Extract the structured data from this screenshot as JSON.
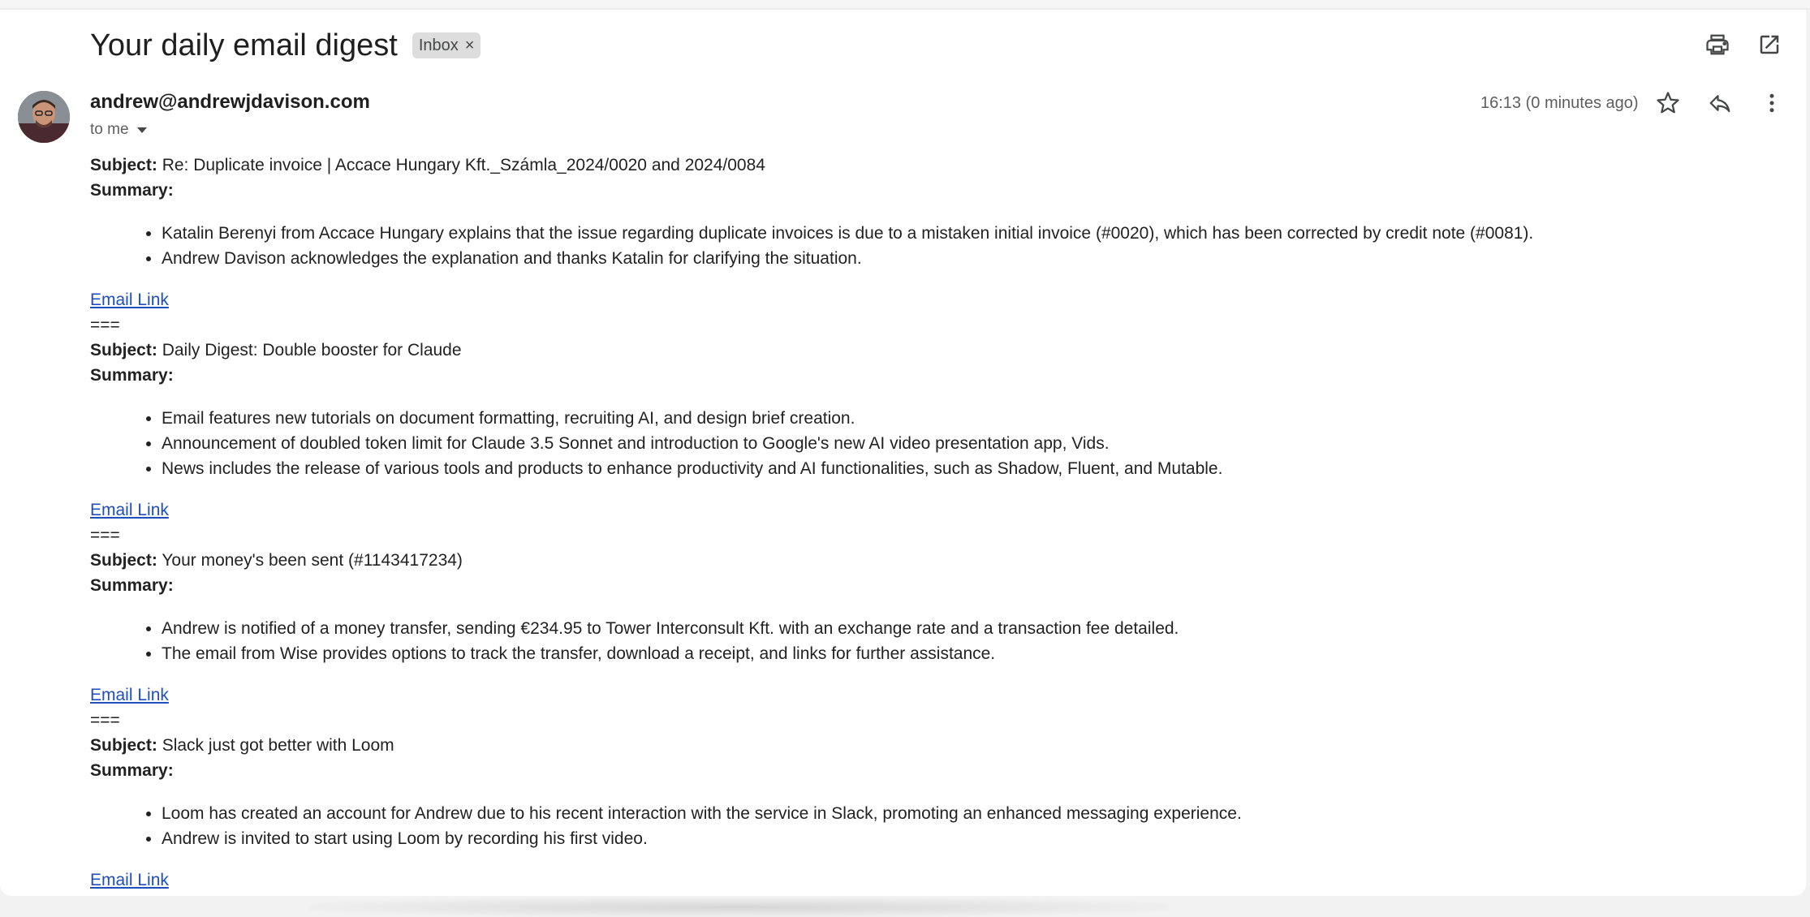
{
  "header": {
    "title": "Your daily email digest",
    "label_chip": "Inbox",
    "chip_close": "×"
  },
  "message": {
    "sender": "andrew@andrewjdavison.com",
    "recipient": "to me",
    "time": "16:13 (0 minutes ago)"
  },
  "icons": {
    "print": "print-icon",
    "open_new_window": "open-in-new-icon",
    "star": "star-icon",
    "reply": "reply-icon",
    "more": "more-vert-icon"
  },
  "digest": {
    "subject_label": "Subject:",
    "summary_label": "Summary:",
    "link_label": "Email Link",
    "separator": "===",
    "items": [
      {
        "subject": "Re: Duplicate invoice | Accace Hungary Kft._Számla_2024/0020 and 2024/0084",
        "bullets": [
          "Katalin Berenyi from Accace Hungary explains that the issue regarding duplicate invoices is due to a mistaken initial invoice (#0020), which has been corrected by credit note (#0081).",
          "Andrew Davison acknowledges the explanation and thanks Katalin for clarifying the situation."
        ]
      },
      {
        "subject": "Daily Digest: Double booster for Claude",
        "bullets": [
          "Email features new tutorials on document formatting, recruiting AI, and design brief creation.",
          "Announcement of doubled token limit for Claude 3.5 Sonnet and introduction to Google's new AI video presentation app, Vids.",
          "News includes the release of various tools and products to enhance productivity and AI functionalities, such as Shadow, Fluent, and Mutable."
        ]
      },
      {
        "subject": "Your money's been sent (#1143417234)",
        "bullets": [
          "Andrew is notified of a money transfer, sending €234.95 to Tower Interconsult Kft. with an exchange rate and a transaction fee detailed.",
          "The email from Wise provides options to track the transfer, download a receipt, and links for further assistance."
        ]
      },
      {
        "subject": "Slack just got better with Loom",
        "bullets": [
          "Loom has created an account for Andrew due to his recent interaction with the service in Slack, promoting an enhanced messaging experience.",
          "Andrew is invited to start using Loom by recording his first video."
        ]
      }
    ]
  }
}
